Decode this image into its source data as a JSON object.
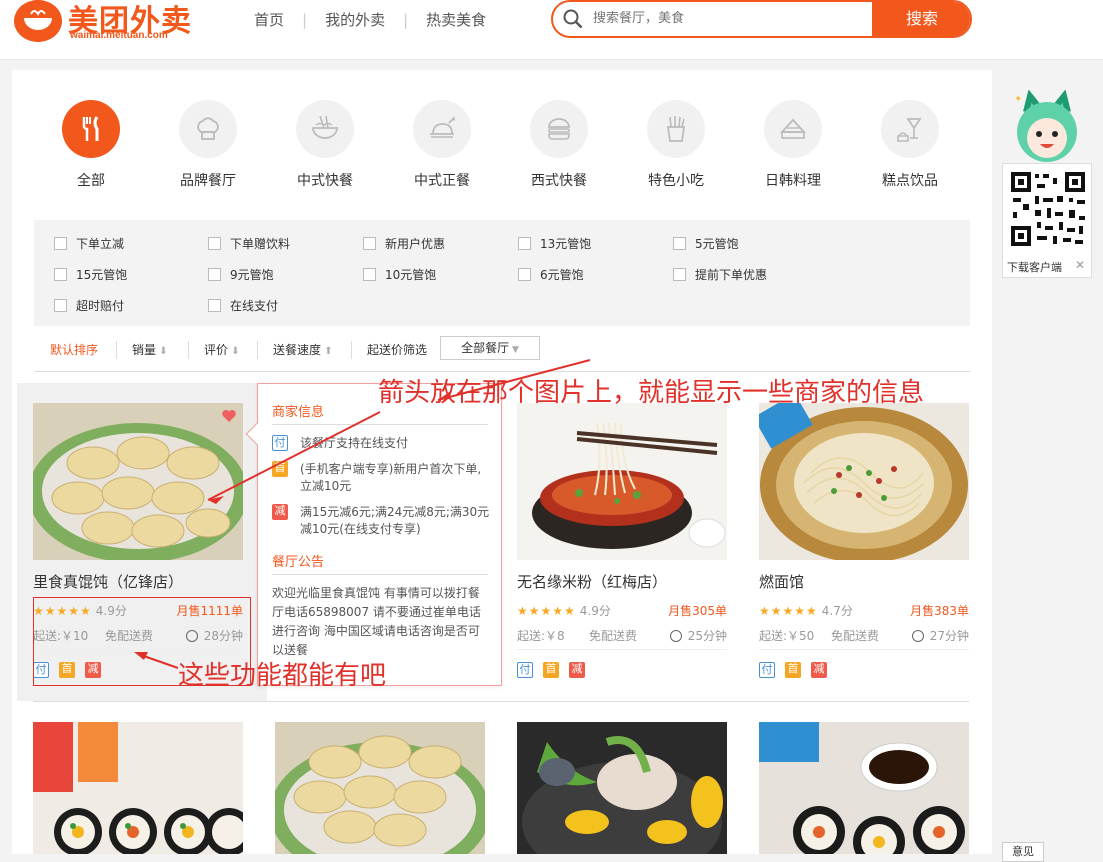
{
  "header": {
    "logo_text": "美团外卖",
    "logo_url": "waimai.meituan.com",
    "nav": [
      "首页",
      "我的外卖",
      "热卖美食"
    ],
    "search_placeholder": "搜索餐厅，美食",
    "search_button": "搜索"
  },
  "categories": [
    {
      "label": "全部",
      "icon": "fork-knife-icon",
      "active": true
    },
    {
      "label": "品牌餐厅",
      "icon": "chef-hat-icon"
    },
    {
      "label": "中式快餐",
      "icon": "noodle-bowl-icon"
    },
    {
      "label": "中式正餐",
      "icon": "roast-chicken-icon"
    },
    {
      "label": "西式快餐",
      "icon": "burger-icon"
    },
    {
      "label": "特色小吃",
      "icon": "fries-icon"
    },
    {
      "label": "日韩料理",
      "icon": "sushi-icon"
    },
    {
      "label": "糕点饮品",
      "icon": "cake-drink-icon"
    }
  ],
  "filters": [
    "下单立减",
    "下单赠饮料",
    "新用户优惠",
    "13元管饱",
    "5元管饱",
    "15元管饱",
    "9元管饱",
    "10元管饱",
    "6元管饱",
    "提前下单优惠",
    "超时赔付",
    "在线支付"
  ],
  "sort": {
    "default": "默认排序",
    "sales": "销量",
    "rating": "评价",
    "speed": "送餐速度",
    "min_price": "起送价筛选",
    "all_restaurants": "全部餐厅"
  },
  "restaurants": [
    {
      "name": "里食真馄饨（亿锋店）",
      "score": "4.9分",
      "sold": "月售1111单",
      "min_order": "起送:￥10",
      "delivery_fee": "免配送费",
      "time": "28分钟",
      "stars": "★★★★★"
    },
    {
      "name": "无名缘米粉（红梅店）",
      "score": "4.9分",
      "sold": "月售305单",
      "min_order": "起送:￥8",
      "delivery_fee": "免配送费",
      "time": "25分钟",
      "stars": "★★★★★"
    },
    {
      "name": "燃面馆",
      "score": "4.7分",
      "sold": "月售383单",
      "min_order": "起送:￥50",
      "delivery_fee": "免配送费",
      "time": "27分钟",
      "stars": "★★★★★"
    }
  ],
  "badges": {
    "fu": "付",
    "shou": "首",
    "jian": "减"
  },
  "popup": {
    "merchant_title": "商家信息",
    "items": [
      {
        "badge": "付",
        "text": "该餐厅支持在线支付"
      },
      {
        "badge": "首",
        "text": "(手机客户端专享)新用户首次下单,立减10元"
      },
      {
        "badge": "减",
        "text": "满15元减6元;满24元减8元;满30元减10元(在线支付专享)"
      }
    ],
    "notice_title": "餐厅公告",
    "notice": "欢迎光临里食真馄饨 有事情可以拨打餐厅电话65898007 请不要通过崔单电话进行咨询 海中国区域请电话咨询是否可以送餐"
  },
  "annotations": {
    "top": "箭头放在那个图片上，就能显示一些商家的信息",
    "bottom": "这些功能都能有吧"
  },
  "sidebar": {
    "download_label": "下载客户端",
    "close": "✕",
    "feedback": "意见"
  },
  "colors": {
    "brand": "#f2571c",
    "annotation": "#e0322b",
    "star": "#f9a825"
  }
}
